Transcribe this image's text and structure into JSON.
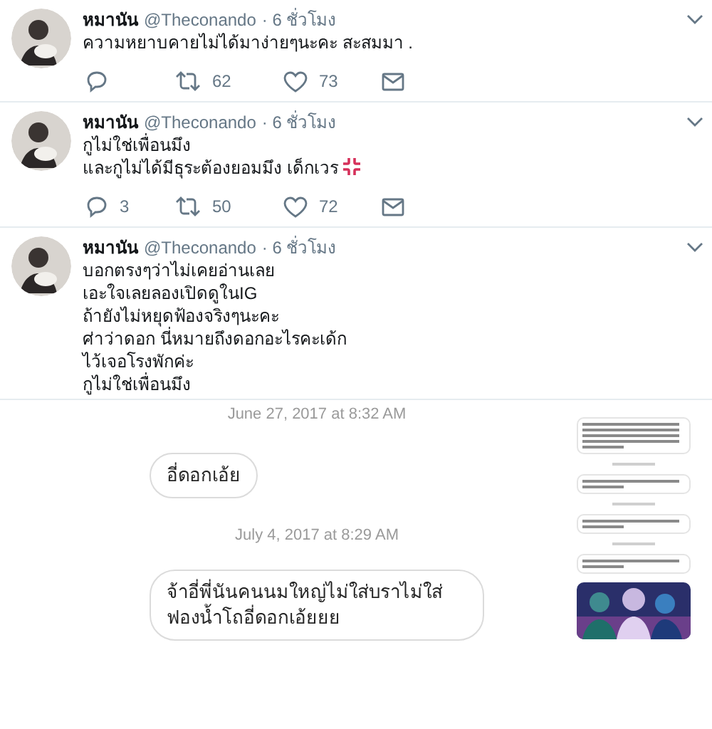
{
  "tweets": [
    {
      "name": "หมานัน",
      "handle": "@Theconando",
      "time": "· 6 ชั่วโมง",
      "lines": [
        "ความหยาบคายไม่ได้มาง่ายๆนะคะ สะสมมา ."
      ],
      "trailing_icon": false,
      "actions": {
        "retweets": "62",
        "likes": "73"
      }
    },
    {
      "name": "หมานัน",
      "handle": "@Theconando",
      "time": "· 6 ชั่วโมง",
      "lines": [
        "กูไม่ใช่เพื่อนมึง",
        "และกูไม่ได้มีธุระต้องยอมมึง เด็กเวร"
      ],
      "trailing_icon": true,
      "actions": {
        "replies": "3",
        "retweets": "50",
        "likes": "72"
      }
    },
    {
      "name": "หมานัน",
      "handle": "@Theconando",
      "time": "· 6 ชั่วโมง",
      "lines": [
        "บอกตรงๆว่าไม่เคยอ่านเลย",
        "เอะใจเลยลองเปิดดูในIG",
        "ถ้ายังไม่หยุดฟ้องจริงๆนะคะ",
        "ศ่าว่าดอก นี่หมายถึงดอกอะไรคะเด้ก",
        "ไว้เจอโรงพักค่ะ",
        "กูไม่ใช่เพื่อนมึง"
      ],
      "trailing_icon": false
    }
  ],
  "embedded_chat": {
    "messages": [
      {
        "kind": "date",
        "text": "June 27, 2017 at 8:32 AM"
      },
      {
        "kind": "bubble",
        "text": "อี่ดอกเอ้ย"
      },
      {
        "kind": "date",
        "text": "July 4, 2017 at 8:29 AM"
      },
      {
        "kind": "bubble",
        "text": "จ้าอี่พี่นันคนนมใหญ่ไม่ใส่บราไม่ใส่ฟองน้ำโถอี่ดอกเอ้ยยย"
      }
    ],
    "side_thread": [
      {
        "kind": "long_bubble"
      },
      {
        "kind": "stamp"
      },
      {
        "kind": "bubble"
      },
      {
        "kind": "stamp"
      },
      {
        "kind": "bubble"
      },
      {
        "kind": "stamp"
      },
      {
        "kind": "bubble"
      },
      {
        "kind": "picture"
      }
    ]
  }
}
